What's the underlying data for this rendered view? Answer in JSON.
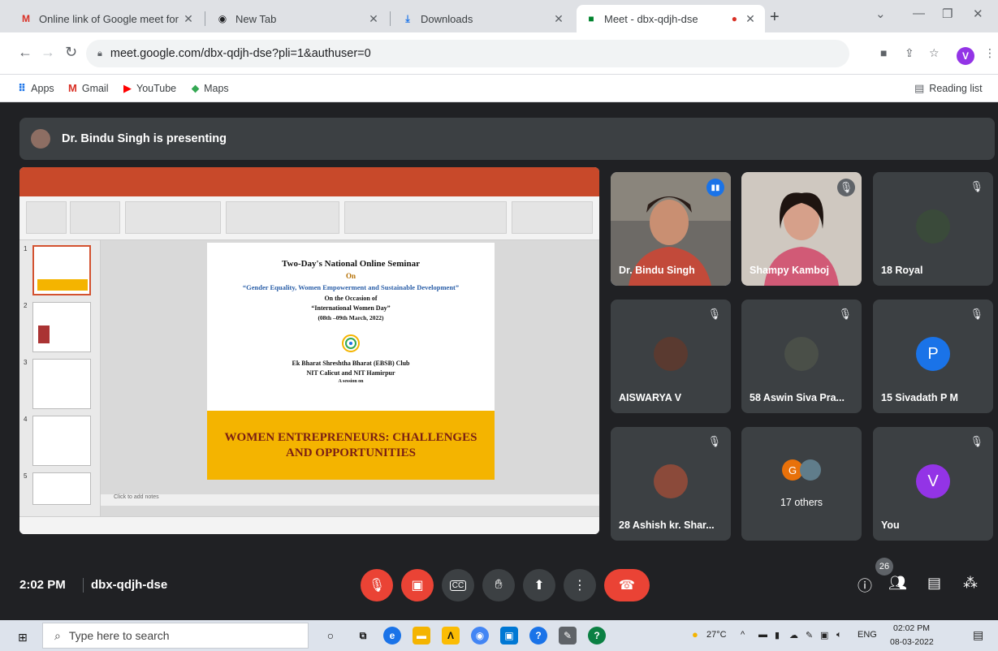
{
  "browser": {
    "tabs": [
      {
        "label": "Online link of Google meet for S",
        "icon": "gmail-icon",
        "active": false
      },
      {
        "label": "New Tab",
        "icon": "chrome-icon",
        "active": false
      },
      {
        "label": "Downloads",
        "icon": "download-icon",
        "active": false
      },
      {
        "label": "Meet - dbx-qdjh-dse",
        "icon": "meet-icon",
        "active": true
      }
    ],
    "address": "meet.google.com/dbx-qdjh-dse?pli=1&authuser=0",
    "profile_initial": "V",
    "bookmarks": [
      {
        "label": "Apps",
        "icon": "apps-grid-icon"
      },
      {
        "label": "Gmail",
        "icon": "gmail-icon"
      },
      {
        "label": "YouTube",
        "icon": "youtube-icon"
      },
      {
        "label": "Maps",
        "icon": "maps-icon"
      }
    ],
    "reading_list": "Reading list"
  },
  "meet": {
    "presenting": "Dr. Bindu Singh is presenting",
    "slide": {
      "lines": [
        "Two-Day's National Online Seminar",
        "On",
        "“Gender Equality, Women Empowerment and Sustainable Development”",
        "On the Occasion of",
        "“International Women Day”",
        "(08th –09th March, 2022)",
        "Ek Bharat Shreshtha Bharat (EBSB) Club",
        "NIT Calicut and NIT Hamirpur",
        "A session on"
      ],
      "banner": [
        "WOMEN ENTREPRENEURS: CHALLENGES",
        "AND OPPORTUNITIES"
      ],
      "notes_placeholder": "Click to add notes",
      "thumb_numbers": [
        "1",
        "2",
        "3",
        "4",
        "5"
      ]
    },
    "participants": [
      {
        "name": "Dr. Bindu Singh",
        "type": "video",
        "speaking": true
      },
      {
        "name": "Shampy Kamboj",
        "type": "video",
        "muted": true
      },
      {
        "name": "18 Royal",
        "type": "photo",
        "muted": true
      },
      {
        "name": "AISWARYA V",
        "type": "photo",
        "muted": true
      },
      {
        "name": "58 Aswin Siva Pra...",
        "type": "photo",
        "muted": true
      },
      {
        "name": "15 Sivadath P M",
        "type": "letter",
        "letter": "P",
        "color": "#1a73e8",
        "muted": true
      },
      {
        "name": "28 Ashish kr. Shar...",
        "type": "photo",
        "muted": true
      },
      {
        "name": "17 others",
        "type": "group",
        "letter": "G",
        "color": "#e8710a"
      },
      {
        "name": "You",
        "type": "letter",
        "letter": "V",
        "color": "#9334e6",
        "muted": true
      }
    ],
    "controls": {
      "time": "2:02 PM",
      "meeting_code": "dbx-qdjh-dse",
      "participant_count": "26"
    }
  },
  "taskbar": {
    "search_placeholder": "Type here to search",
    "temperature": "27°C",
    "lang": "ENG",
    "time": "02:02 PM",
    "date": "08-03-2022"
  }
}
